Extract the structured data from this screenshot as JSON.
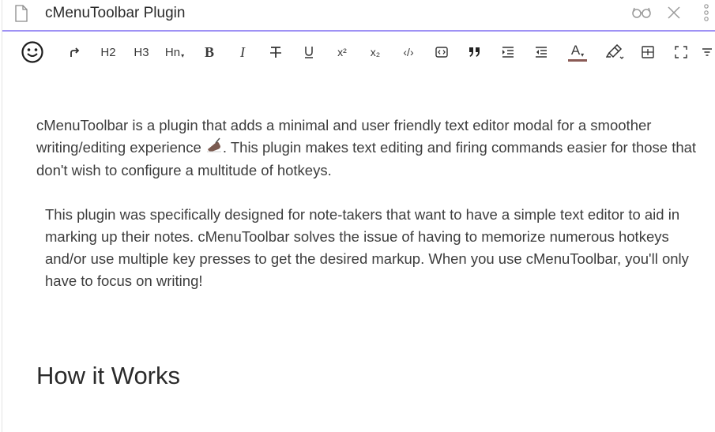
{
  "header": {
    "title": "cMenuToolbar Plugin"
  },
  "toolbar": {
    "items": [
      {
        "icon": "smiley-icon"
      },
      {
        "icon": "redo-icon"
      },
      {
        "label": "H2"
      },
      {
        "label": "H3"
      },
      {
        "label": "Hn"
      },
      {
        "label": "B"
      },
      {
        "label": "I"
      },
      {
        "icon": "strikethrough-icon"
      },
      {
        "icon": "underline-icon"
      },
      {
        "label": "x²"
      },
      {
        "label": "x₂"
      },
      {
        "label": "‹/›"
      },
      {
        "icon": "codeblock-icon"
      },
      {
        "icon": "quote-icon"
      },
      {
        "icon": "indent-icon"
      },
      {
        "icon": "outdent-icon"
      },
      {
        "label": "A"
      },
      {
        "icon": "highlighter-icon"
      },
      {
        "icon": "table-icon"
      },
      {
        "icon": "fullscreen-icon"
      },
      {
        "icon": "more-icon"
      }
    ],
    "font_color": "#8a5a55"
  },
  "content": {
    "paragraph1_before": "cMenuToolbar is a plugin that adds a minimal and user friendly text editor modal for a smoother writing/editing experience ",
    "paragraph1_after": ". This plugin makes text editing and firing commands easier for those that don't wish to configure a multitude of hotkeys.",
    "paragraph2": "This plugin was specifically designed for note-takers that want to have a simple text editor to aid in marking up their notes. cMenuToolbar solves the issue of having to memorize numerous hotkeys and/or use multiple key presses to get the desired markup. When you use cMenuToolbar, you'll only have to focus on writing!",
    "heading": "How it Works"
  },
  "colors": {
    "accent": "#7f6df2"
  }
}
